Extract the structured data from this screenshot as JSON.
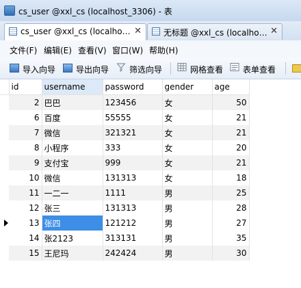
{
  "window": {
    "title": "cs_user @xxl_cs (localhost_3306) - 表"
  },
  "tabs": [
    {
      "label": "cs_user @xxl_cs (localho…",
      "close": "✕",
      "active": true
    },
    {
      "label": "无标题 @xxl_cs (localho…",
      "close": "✕",
      "active": false
    }
  ],
  "menu": [
    "文件(F)",
    "编辑(E)",
    "查看(V)",
    "窗口(W)",
    "帮助(H)"
  ],
  "toolbar": {
    "import": "导入向导",
    "export": "导出向导",
    "filter": "筛选向导",
    "grid_view": "网格查看",
    "form_view": "表单查看"
  },
  "table": {
    "columns": [
      "id",
      "username",
      "password",
      "gender",
      "age"
    ],
    "rows": [
      {
        "id": "2",
        "username": "巴巴",
        "password": "123456",
        "gender": "女",
        "age": "50"
      },
      {
        "id": "6",
        "username": "百度",
        "password": "55555",
        "gender": "女",
        "age": "21"
      },
      {
        "id": "7",
        "username": "微信",
        "password": "321321",
        "gender": "女",
        "age": "21"
      },
      {
        "id": "8",
        "username": "小程序",
        "password": "333",
        "gender": "女",
        "age": "20"
      },
      {
        "id": "9",
        "username": "支付宝",
        "password": "999",
        "gender": "女",
        "age": "21"
      },
      {
        "id": "10",
        "username": "微信",
        "password": "131313",
        "gender": "女",
        "age": "18"
      },
      {
        "id": "11",
        "username": "一二一",
        "password": "1111",
        "gender": "男",
        "age": "25"
      },
      {
        "id": "12",
        "username": "张三",
        "password": "131313",
        "gender": "男",
        "age": "28"
      },
      {
        "id": "13",
        "username": "张四",
        "password": "121212",
        "gender": "男",
        "age": "27"
      },
      {
        "id": "14",
        "username": "张2123",
        "password": "313131",
        "gender": "男",
        "age": "35"
      },
      {
        "id": "15",
        "username": "王尼玛",
        "password": "242424",
        "gender": "男",
        "age": "30"
      }
    ],
    "selected_row_index": 8,
    "selected_column": "username"
  }
}
